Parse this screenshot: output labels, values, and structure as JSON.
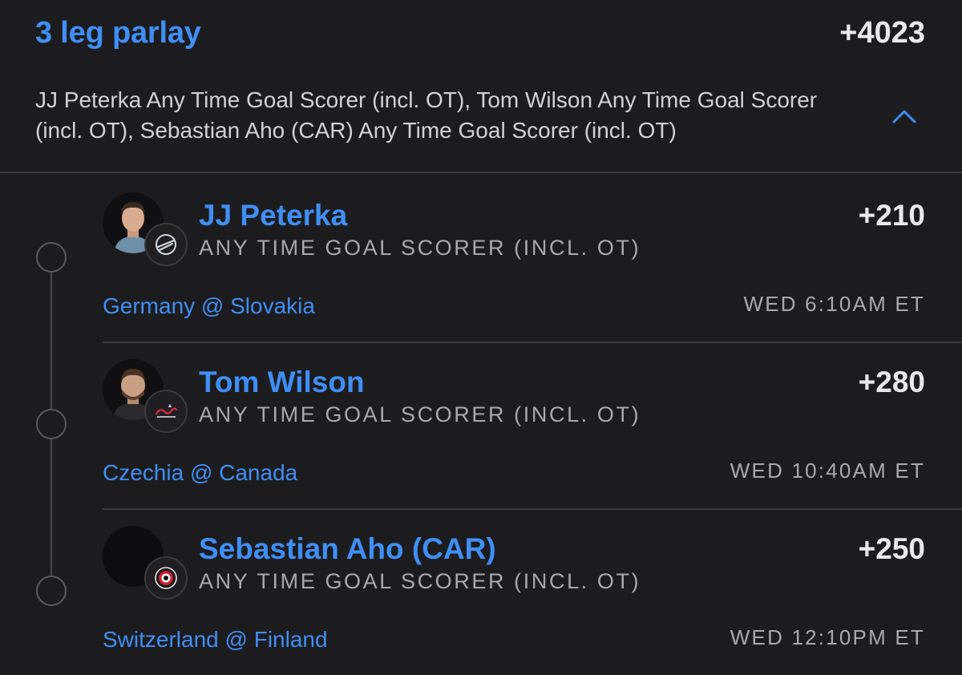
{
  "parlay": {
    "title": "3 leg parlay",
    "odds": "+4023",
    "description": "JJ Peterka Any Time Goal Scorer (incl. OT), Tom Wilson Any Time Goal Scorer (incl. OT), Sebastian Aho (CAR) Any Time Goal Scorer (incl. OT)",
    "toggle_icon": "chevron-up-icon"
  },
  "legs": [
    {
      "player": "JJ Peterka",
      "market": "ANY TIME GOAL SCORER (INCL. OT)",
      "odds": "+210",
      "matchup": "Germany @ Slovakia",
      "time": "WED 6:10AM ET",
      "team_icon": "sabres-logo-icon"
    },
    {
      "player": "Tom Wilson",
      "market": "ANY TIME GOAL SCORER (INCL. OT)",
      "odds": "+280",
      "matchup": "Czechia @ Canada",
      "time": "WED 10:40AM ET",
      "team_icon": "capitals-logo-icon"
    },
    {
      "player": "Sebastian Aho (CAR)",
      "market": "ANY TIME GOAL SCORER (INCL. OT)",
      "odds": "+250",
      "matchup": "Switzerland @ Finland",
      "time": "WED 12:10PM ET",
      "team_icon": "hurricanes-logo-icon"
    }
  ],
  "colors": {
    "background": "#1c1c1e",
    "accent_blue": "#3f8ef5",
    "primary_text": "#e9e9eb",
    "secondary_text": "#a8a8ad",
    "divider": "#3a3a3c"
  }
}
